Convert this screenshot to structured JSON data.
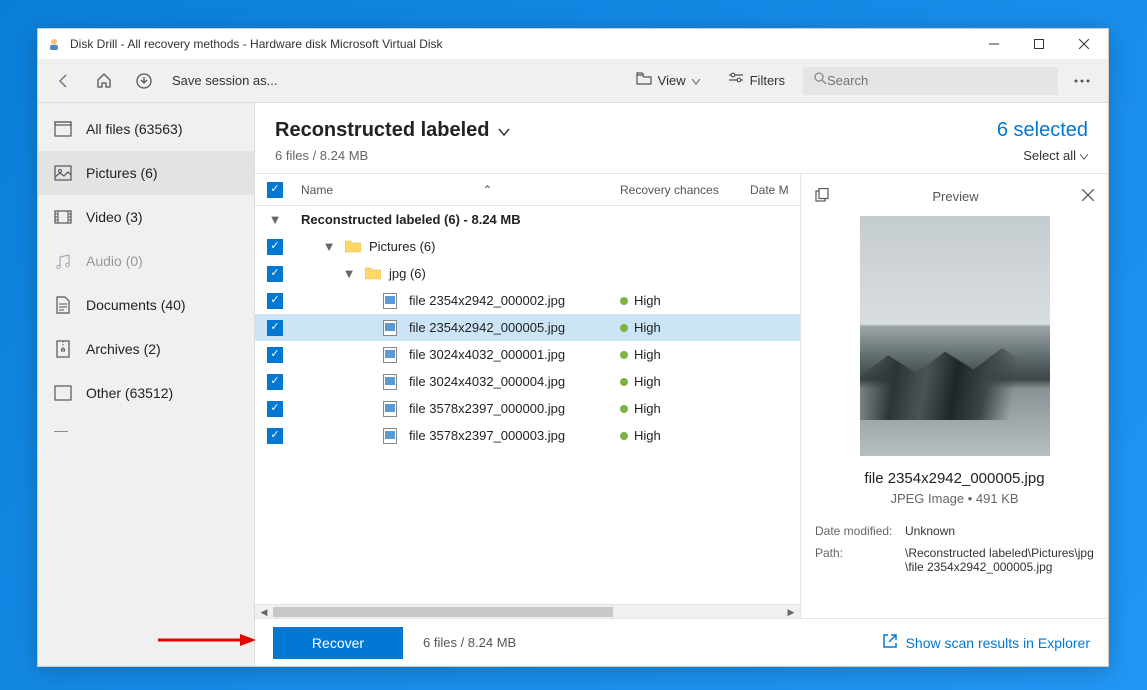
{
  "window": {
    "title": "Disk Drill - All recovery methods - Hardware disk Microsoft Virtual Disk"
  },
  "toolbar": {
    "save_session": "Save session as...",
    "view": "View",
    "filters": "Filters",
    "search_placeholder": "Search"
  },
  "sidebar": {
    "items": [
      {
        "label": "All files (63563)",
        "icon": "all"
      },
      {
        "label": "Pictures (6)",
        "icon": "pictures",
        "active": true
      },
      {
        "label": "Video (3)",
        "icon": "video"
      },
      {
        "label": "Audio (0)",
        "icon": "audio",
        "disabled": true
      },
      {
        "label": "Documents (40)",
        "icon": "documents"
      },
      {
        "label": "Archives (2)",
        "icon": "archives"
      },
      {
        "label": "Other (63512)",
        "icon": "other"
      }
    ]
  },
  "header": {
    "title": "Reconstructed labeled",
    "subtitle": "6 files / 8.24 MB",
    "selected": "6 selected",
    "select_all": "Select all"
  },
  "columns": {
    "name": "Name",
    "recovery": "Recovery chances",
    "date": "Date M"
  },
  "tree": {
    "root": "Reconstructed labeled (6) - 8.24 MB",
    "folder1": "Pictures (6)",
    "folder2": "jpg (6)",
    "files": [
      {
        "name": "file 2354x2942_000002.jpg",
        "chance": "High"
      },
      {
        "name": "file 2354x2942_000005.jpg",
        "chance": "High",
        "selected": true
      },
      {
        "name": "file 3024x4032_000001.jpg",
        "chance": "High"
      },
      {
        "name": "file 3024x4032_000004.jpg",
        "chance": "High"
      },
      {
        "name": "file 3578x2397_000000.jpg",
        "chance": "High"
      },
      {
        "name": "file 3578x2397_000003.jpg",
        "chance": "High"
      }
    ]
  },
  "preview": {
    "label": "Preview",
    "filename": "file 2354x2942_000005.jpg",
    "meta": "JPEG Image • 491 KB",
    "date_modified_k": "Date modified:",
    "date_modified_v": "Unknown",
    "path_k": "Path:",
    "path_v": "\\Reconstructed labeled\\Pictures\\jpg\\file 2354x2942_000005.jpg"
  },
  "footer": {
    "recover": "Recover",
    "info": "6 files / 8.24 MB",
    "explorer": "Show scan results in Explorer"
  }
}
